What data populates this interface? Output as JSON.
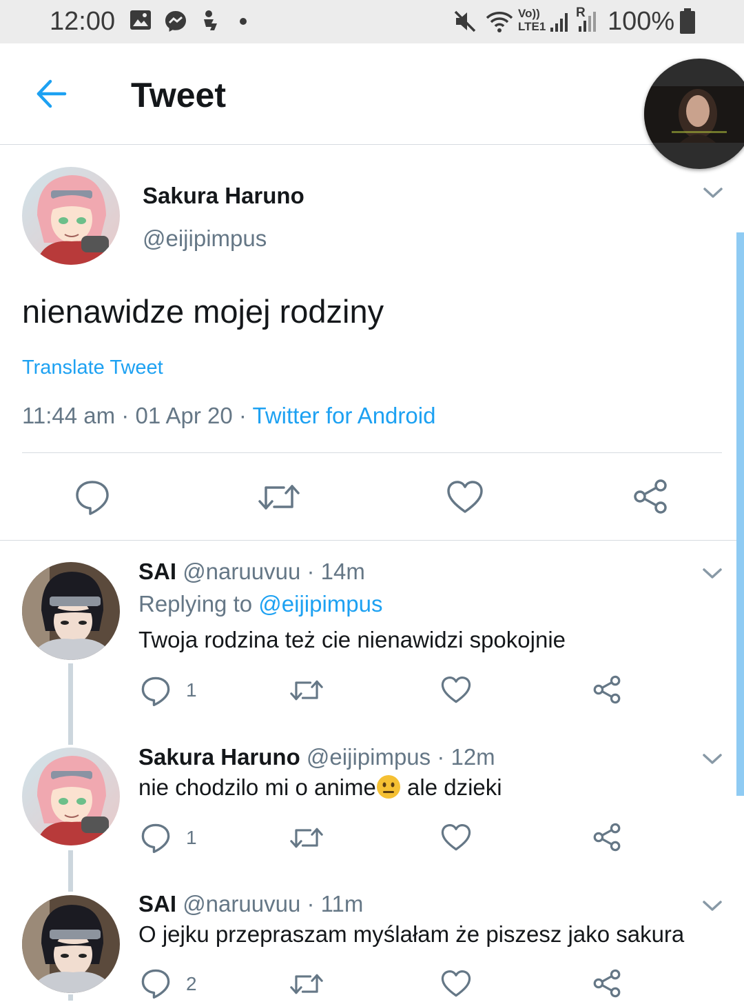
{
  "status_bar": {
    "time": "12:00",
    "net_label_top": "Vo))",
    "net_label_bottom": "LTE1",
    "roaming": "R",
    "battery": "100%"
  },
  "header": {
    "title": "Tweet"
  },
  "tweet": {
    "name": "Sakura Haruno",
    "handle": "@eijipimpus",
    "text": "nienawidze mojej rodziny",
    "translate": "Translate Tweet",
    "timestamp": "11:44 am · 01 Apr 20 · ",
    "source": "Twitter for Android"
  },
  "replies": [
    {
      "name": "SAI",
      "meta": "@naruuvuu · 14m",
      "replying_prefix": "Replying to ",
      "replying_handle": "@eijipimpus",
      "text": "Twoja rodzina też cie nienawidzi spokojnie",
      "reply_count": "1"
    },
    {
      "name": "Sakura Haruno",
      "meta": "@eijipimpus · 12m",
      "text_before": "nie chodzilo mi o anime",
      "text_after": " ale dzieki",
      "reply_count": "1"
    },
    {
      "name": "SAI",
      "meta": "@naruuvuu · 11m",
      "text": "O jejku przepraszam myślałam że piszesz jako sakura",
      "reply_count": "2"
    }
  ],
  "colors": {
    "accent": "#1da1f2",
    "text": "#14171a",
    "secondary": "#657786",
    "divider": "#d6dbe0",
    "status_bar": "#ececec"
  }
}
